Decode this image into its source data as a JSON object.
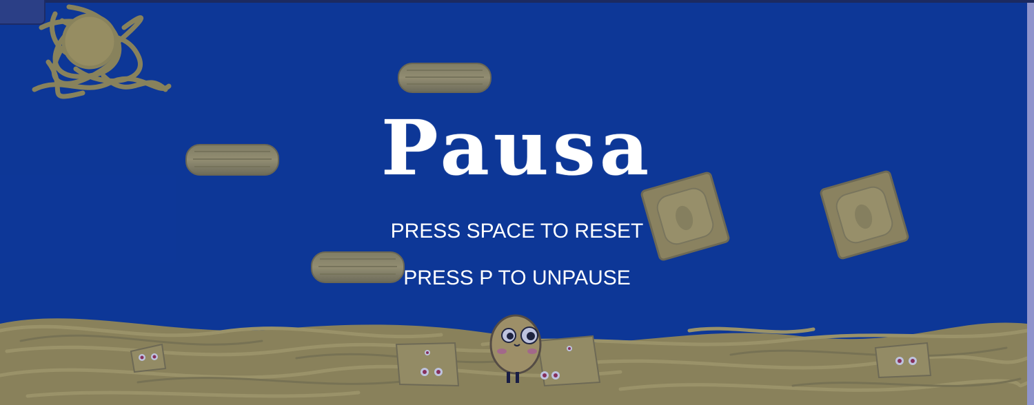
{
  "pause_menu": {
    "title": "Pausa",
    "reset_hint": "PRESS SPACE TO RESET",
    "unpause_hint": "PRESS P TO UNPAUSE"
  },
  "colors": {
    "sky": "#0a3d9c",
    "pasta": "#c9b54a",
    "text": "#ffffff"
  }
}
